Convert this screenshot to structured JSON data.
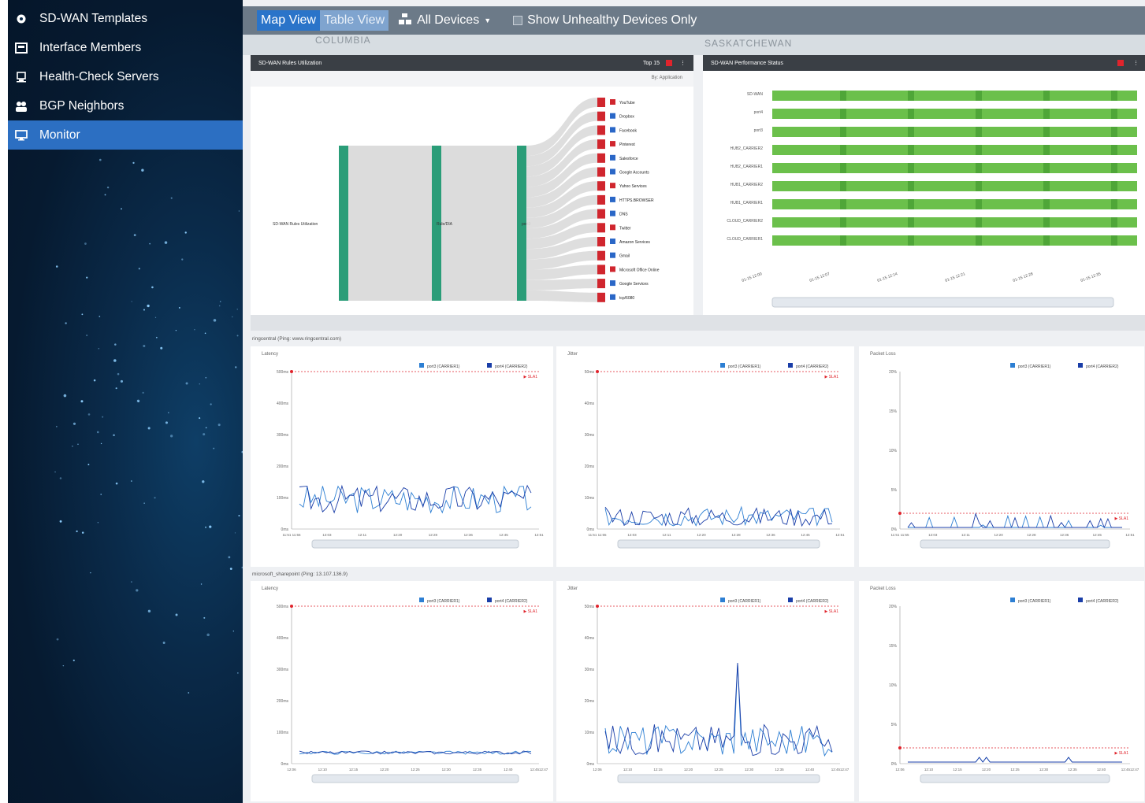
{
  "sidebar": {
    "items": [
      {
        "label": "SD-WAN Templates",
        "icon": "gear-cloud-icon"
      },
      {
        "label": "Interface Members",
        "icon": "monitor-box-icon"
      },
      {
        "label": "Health-Check Servers",
        "icon": "server-icon"
      },
      {
        "label": "BGP Neighbors",
        "icon": "people-icon"
      },
      {
        "label": "Monitor",
        "icon": "monitor-icon",
        "active": true
      }
    ]
  },
  "toolbar": {
    "map_view": "Map View",
    "table_view": "Table View",
    "devices": "All Devices",
    "unhealthy": "Show Unhealthy Devices Only"
  },
  "map": {
    "label1": "COLUMBIA",
    "label2": "SASKATCHEWAN"
  },
  "rules_panel": {
    "title": "SD-WAN Rules Utilization",
    "top": "Top 15",
    "by": "By: Application",
    "nodes": [
      "SD-WAN Rules Utilization",
      "Rule/DIA",
      "port3"
    ],
    "apps": [
      "YouTube",
      "Dropbox",
      "Facebook",
      "Pinterest",
      "Salesforce",
      "Google Accounts",
      "Yahoo Services",
      "HTTPS.BROWSER",
      "DNS",
      "Twitter",
      "Amazon Services",
      "Gmail",
      "Microsoft Office Online",
      "Google Services",
      "tcp/6080"
    ]
  },
  "perf_panel": {
    "title": "SD-WAN Performance Status",
    "rows": [
      "SD-WAN",
      "port4",
      "port3",
      "HUB2_CARRIER2",
      "HUB2_CARRIER1",
      "HUB1_CARRIER2",
      "HUB1_CARRIER1",
      "CLOUD_CARRIER2",
      "CLOUD_CARRIER1"
    ],
    "times": [
      "01-15 12:00",
      "01-15 12:07",
      "01-15 12:14",
      "01-15 12:21",
      "01-15 12:28",
      "01-15 12:35"
    ]
  },
  "sections": [
    {
      "label": "ringcentral (Ping: www.ringcentral.com)",
      "charts": [
        {
          "title": "Latency",
          "yticks": [
            "0ms",
            "100ms",
            "200ms",
            "300ms",
            "400ms",
            "500ms"
          ],
          "sla": "SLA1",
          "legend": [
            "port3 (CARRIER1)",
            "port4 (CARRIER2)"
          ],
          "xticks": [
            "11:51 11:55",
            "12:03",
            "12:11",
            "12:20",
            "12:28",
            "12:36",
            "12:45",
            "12:51"
          ]
        },
        {
          "title": "Jitter",
          "yticks": [
            "0ms",
            "10ms",
            "20ms",
            "30ms",
            "40ms",
            "50ms"
          ],
          "sla": "SLA1",
          "legend": [
            "port3 (CARRIER1)",
            "port4 (CARRIER2)"
          ],
          "xticks": [
            "11:51 11:55",
            "12:03",
            "12:11",
            "12:20",
            "12:28",
            "12:36",
            "12:45",
            "12:51"
          ]
        },
        {
          "title": "Packet Loss",
          "yticks": [
            "0%",
            "5%",
            "10%",
            "15%",
            "20%"
          ],
          "sla": "SLA1",
          "legend": [
            "port3 (CARRIER1)",
            "port4 (CARRIER2)"
          ],
          "xticks": [
            "11:51 11:55",
            "12:03",
            "12:11",
            "12:20",
            "12:28",
            "12:36",
            "12:45",
            "12:51"
          ]
        }
      ]
    },
    {
      "label": "microsoft_sharepoint (Ping: 13.107.136.9)",
      "charts": [
        {
          "title": "Latency",
          "yticks": [
            "0ms",
            "100ms",
            "200ms",
            "300ms",
            "400ms",
            "500ms"
          ],
          "sla": "SLA1",
          "legend": [
            "port3 (CARRIER1)",
            "port4 (CARRIER2)"
          ],
          "xticks": [
            "12:06",
            "12:10",
            "12:15",
            "12:20",
            "12:25",
            "12:30",
            "12:35",
            "12:40",
            "12:4512:47"
          ]
        },
        {
          "title": "Jitter",
          "yticks": [
            "0ms",
            "10ms",
            "20ms",
            "30ms",
            "40ms",
            "50ms"
          ],
          "sla": "SLA1",
          "legend": [
            "port3 (CARRIER1)",
            "port4 (CARRIER2)"
          ],
          "xticks": [
            "12:06",
            "12:10",
            "12:15",
            "12:20",
            "12:25",
            "12:30",
            "12:35",
            "12:40",
            "12:4512:47"
          ]
        },
        {
          "title": "Packet Loss",
          "yticks": [
            "0%",
            "5%",
            "10%",
            "15%",
            "20%"
          ],
          "sla": "SLA1",
          "legend": [
            "port3 (CARRIER1)",
            "port4 (CARRIER2)"
          ],
          "xticks": [
            "12:06",
            "12:10",
            "12:15",
            "12:20",
            "12:25",
            "12:30",
            "12:35",
            "12:40",
            "12:4512:47"
          ]
        }
      ]
    }
  ],
  "colors": {
    "accent": "#2c6fc2",
    "carrier1": "#2d7fd3",
    "carrier2": "#1a3ea8",
    "sla": "#e0242c",
    "health": "#6bc04b"
  }
}
